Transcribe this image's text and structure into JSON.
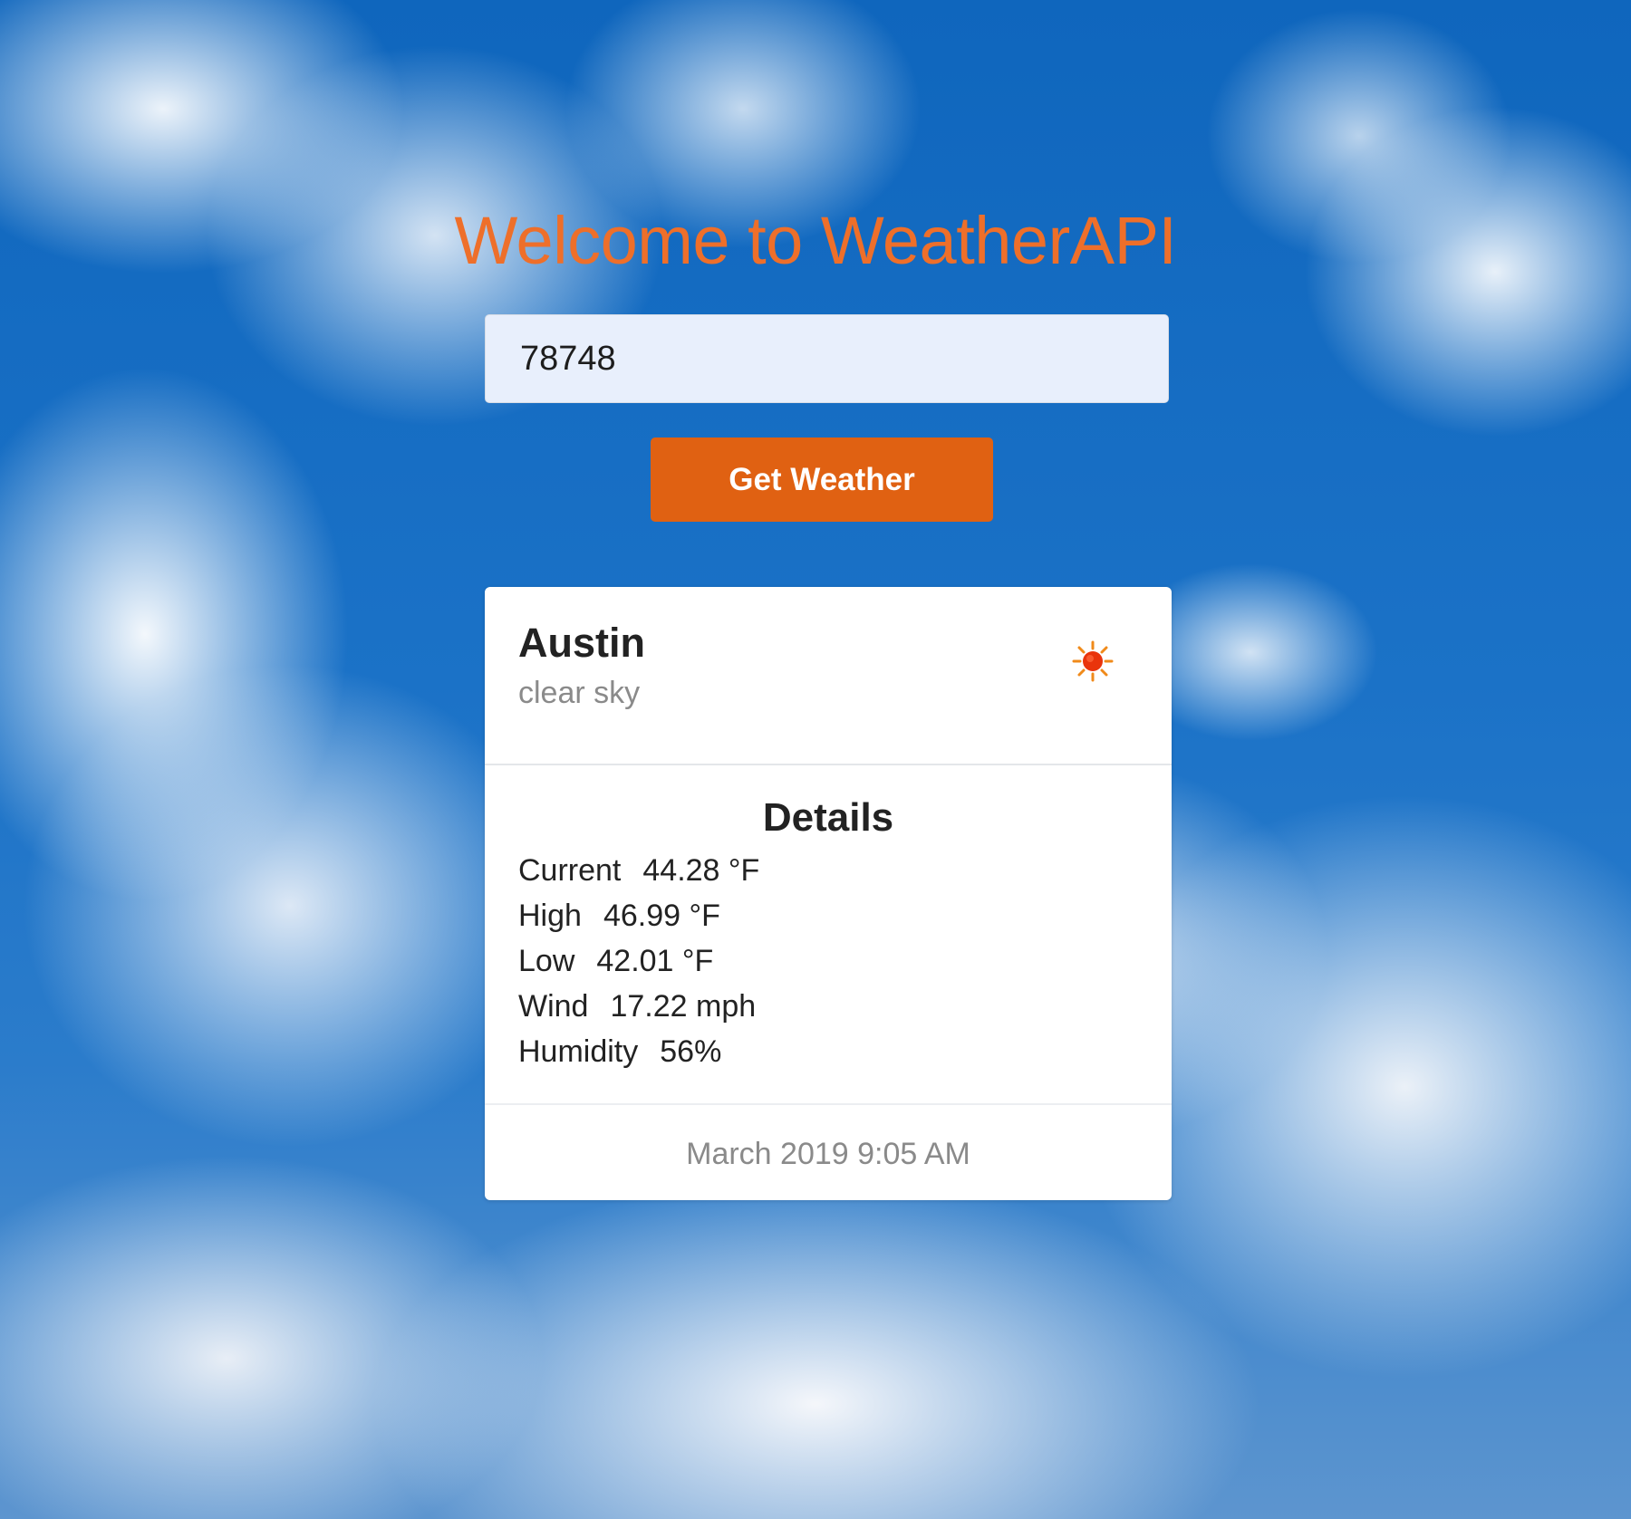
{
  "page": {
    "title": "Welcome to WeatherAPI"
  },
  "search": {
    "value": "78748",
    "button_label": "Get Weather"
  },
  "weather": {
    "city": "Austin",
    "description": "clear sky",
    "icon": "sun-icon",
    "details_heading": "Details",
    "details": [
      {
        "label": "Current",
        "value": "44.28 °F"
      },
      {
        "label": "High",
        "value": "46.99 °F"
      },
      {
        "label": "Low",
        "value": "42.01 °F"
      },
      {
        "label": "Wind",
        "value": "17.22 mph"
      },
      {
        "label": "Humidity",
        "value": "56%"
      }
    ],
    "timestamp": "March 2019 9:05 AM"
  },
  "colors": {
    "title": "#ee6f2a",
    "button": "#e06112",
    "input_bg": "#e8effc",
    "sun": "#e9340c"
  }
}
